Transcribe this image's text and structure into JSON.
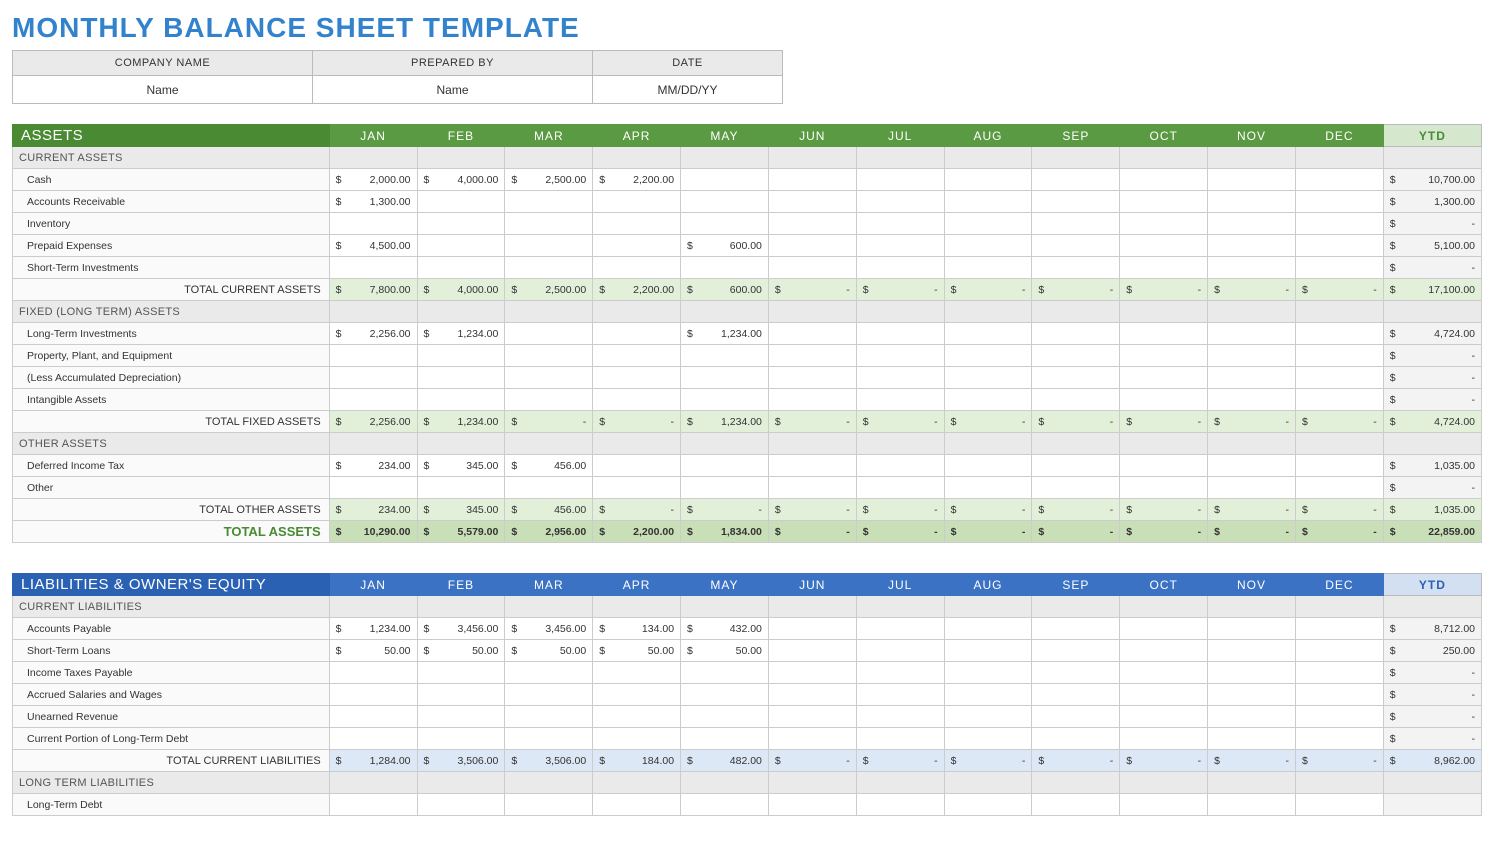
{
  "title": "MONTHLY BALANCE SHEET TEMPLATE",
  "meta": {
    "headers": [
      "COMPANY NAME",
      "PREPARED BY",
      "DATE"
    ],
    "values": [
      "Name",
      "Name",
      "MM/DD/YY"
    ]
  },
  "currency": "$",
  "dash": "-",
  "months": [
    "JAN",
    "FEB",
    "MAR",
    "APR",
    "MAY",
    "JUN",
    "JUL",
    "AUG",
    "SEP",
    "OCT",
    "NOV",
    "DEC"
  ],
  "ytd_label": "YTD",
  "assets": {
    "title": "ASSETS",
    "groups": [
      {
        "name": "CURRENT ASSETS",
        "rows": [
          {
            "label": "Cash",
            "m": [
              "2,000.00",
              "4,000.00",
              "2,500.00",
              "2,200.00",
              "",
              "",
              "",
              "",
              "",
              "",
              "",
              ""
            ],
            "ytd": "10,700.00"
          },
          {
            "label": "Accounts Receivable",
            "m": [
              "1,300.00",
              "",
              "",
              "",
              "",
              "",
              "",
              "",
              "",
              "",
              "",
              ""
            ],
            "ytd": "1,300.00"
          },
          {
            "label": "Inventory",
            "m": [
              "",
              "",
              "",
              "",
              "",
              "",
              "",
              "",
              "",
              "",
              "",
              ""
            ],
            "ytd": "-"
          },
          {
            "label": "Prepaid Expenses",
            "m": [
              "4,500.00",
              "",
              "",
              "",
              "600.00",
              "",
              "",
              "",
              "",
              "",
              "",
              ""
            ],
            "ytd": "5,100.00"
          },
          {
            "label": "Short-Term Investments",
            "m": [
              "",
              "",
              "",
              "",
              "",
              "",
              "",
              "",
              "",
              "",
              "",
              ""
            ],
            "ytd": "-"
          }
        ],
        "subtotal": {
          "label": "TOTAL CURRENT ASSETS",
          "m": [
            "7,800.00",
            "4,000.00",
            "2,500.00",
            "2,200.00",
            "600.00",
            "-",
            "-",
            "-",
            "-",
            "-",
            "-",
            "-"
          ],
          "ytd": "17,100.00"
        }
      },
      {
        "name": "FIXED (LONG TERM) ASSETS",
        "rows": [
          {
            "label": "Long-Term Investments",
            "m": [
              "2,256.00",
              "1,234.00",
              "",
              "",
              "1,234.00",
              "",
              "",
              "",
              "",
              "",
              "",
              ""
            ],
            "ytd": "4,724.00"
          },
          {
            "label": "Property, Plant, and Equipment",
            "m": [
              "",
              "",
              "",
              "",
              "",
              "",
              "",
              "",
              "",
              "",
              "",
              ""
            ],
            "ytd": "-"
          },
          {
            "label": "(Less Accumulated Depreciation)",
            "m": [
              "",
              "",
              "",
              "",
              "",
              "",
              "",
              "",
              "",
              "",
              "",
              ""
            ],
            "ytd": "-"
          },
          {
            "label": "Intangible Assets",
            "m": [
              "",
              "",
              "",
              "",
              "",
              "",
              "",
              "",
              "",
              "",
              "",
              ""
            ],
            "ytd": "-"
          }
        ],
        "subtotal": {
          "label": "TOTAL FIXED ASSETS",
          "m": [
            "2,256.00",
            "1,234.00",
            "-",
            "-",
            "1,234.00",
            "-",
            "-",
            "-",
            "-",
            "-",
            "-",
            "-"
          ],
          "ytd": "4,724.00"
        }
      },
      {
        "name": "OTHER ASSETS",
        "rows": [
          {
            "label": "Deferred Income Tax",
            "m": [
              "234.00",
              "345.00",
              "456.00",
              "",
              "",
              "",
              "",
              "",
              "",
              "",
              "",
              ""
            ],
            "ytd": "1,035.00"
          },
          {
            "label": "Other",
            "m": [
              "",
              "",
              "",
              "",
              "",
              "",
              "",
              "",
              "",
              "",
              "",
              ""
            ],
            "ytd": "-"
          }
        ],
        "subtotal": {
          "label": "TOTAL OTHER ASSETS",
          "m": [
            "234.00",
            "345.00",
            "456.00",
            "-",
            "-",
            "-",
            "-",
            "-",
            "-",
            "-",
            "-",
            "-"
          ],
          "ytd": "1,035.00"
        }
      }
    ],
    "grand": {
      "label": "TOTAL ASSETS",
      "m": [
        "10,290.00",
        "5,579.00",
        "2,956.00",
        "2,200.00",
        "1,834.00",
        "-",
        "-",
        "-",
        "-",
        "-",
        "-",
        "-"
      ],
      "ytd": "22,859.00"
    }
  },
  "liab": {
    "title": "LIABILITIES & OWNER'S EQUITY",
    "groups": [
      {
        "name": "CURRENT LIABILITIES",
        "rows": [
          {
            "label": "Accounts Payable",
            "m": [
              "1,234.00",
              "3,456.00",
              "3,456.00",
              "134.00",
              "432.00",
              "",
              "",
              "",
              "",
              "",
              "",
              ""
            ],
            "ytd": "8,712.00"
          },
          {
            "label": "Short-Term Loans",
            "m": [
              "50.00",
              "50.00",
              "50.00",
              "50.00",
              "50.00",
              "",
              "",
              "",
              "",
              "",
              "",
              ""
            ],
            "ytd": "250.00"
          },
          {
            "label": "Income Taxes Payable",
            "m": [
              "",
              "",
              "",
              "",
              "",
              "",
              "",
              "",
              "",
              "",
              "",
              ""
            ],
            "ytd": "-"
          },
          {
            "label": "Accrued Salaries and Wages",
            "m": [
              "",
              "",
              "",
              "",
              "",
              "",
              "",
              "",
              "",
              "",
              "",
              ""
            ],
            "ytd": "-"
          },
          {
            "label": "Unearned Revenue",
            "m": [
              "",
              "",
              "",
              "",
              "",
              "",
              "",
              "",
              "",
              "",
              "",
              ""
            ],
            "ytd": "-"
          },
          {
            "label": "Current Portion of Long-Term Debt",
            "m": [
              "",
              "",
              "",
              "",
              "",
              "",
              "",
              "",
              "",
              "",
              "",
              ""
            ],
            "ytd": "-"
          }
        ],
        "subtotal": {
          "label": "TOTAL CURRENT LIABILITIES",
          "m": [
            "1,284.00",
            "3,506.00",
            "3,506.00",
            "184.00",
            "482.00",
            "-",
            "-",
            "-",
            "-",
            "-",
            "-",
            "-"
          ],
          "ytd": "8,962.00"
        }
      },
      {
        "name": "LONG TERM LIABILITIES",
        "rows": [
          {
            "label": "Long-Term Debt",
            "m": [
              "",
              "",
              "",
              "",
              "",
              "",
              "",
              "",
              "",
              "",
              "",
              ""
            ],
            "ytd": ""
          }
        ],
        "subtotal": null
      }
    ],
    "grand": null
  }
}
